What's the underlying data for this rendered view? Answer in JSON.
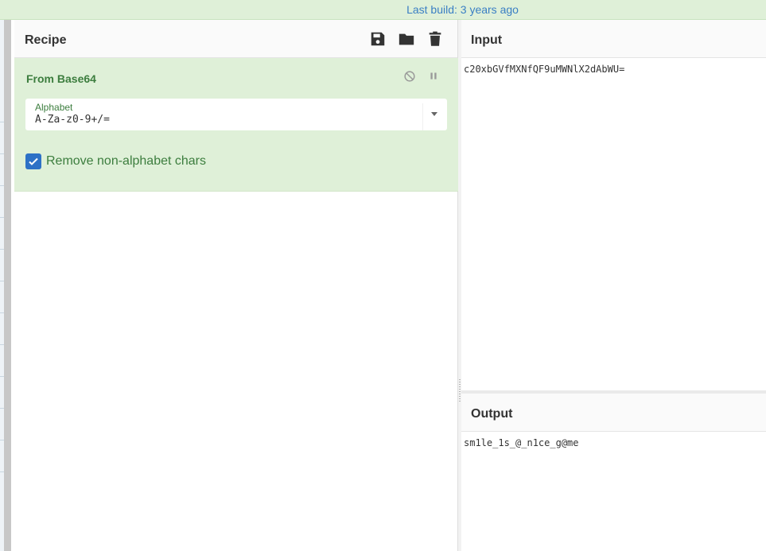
{
  "topbar": {
    "text": "Last build: 3 years ago"
  },
  "recipe": {
    "title": "Recipe",
    "icons": [
      "save-icon",
      "folder-icon",
      "trash-icon"
    ],
    "operation": {
      "title": "From Base64",
      "icons": [
        "disable-icon",
        "pause-icon"
      ],
      "alphabet": {
        "label": "Alphabet",
        "value": "A-Za-z0-9+/="
      },
      "remove_non_alphabet": {
        "label": "Remove non-alphabet chars",
        "checked": true
      }
    }
  },
  "input": {
    "title": "Input",
    "value": "c20xbGVfMXNfQF9uMWNlX2dAbWU="
  },
  "output": {
    "title": "Output",
    "value": "sm1le_1s_@_n1ce_g@me"
  },
  "colors": {
    "accent_green": "#3c7d3e",
    "op_bg": "#dff0d8",
    "checkbox_blue": "#2d71c6",
    "link_blue": "#3a7fc4"
  }
}
